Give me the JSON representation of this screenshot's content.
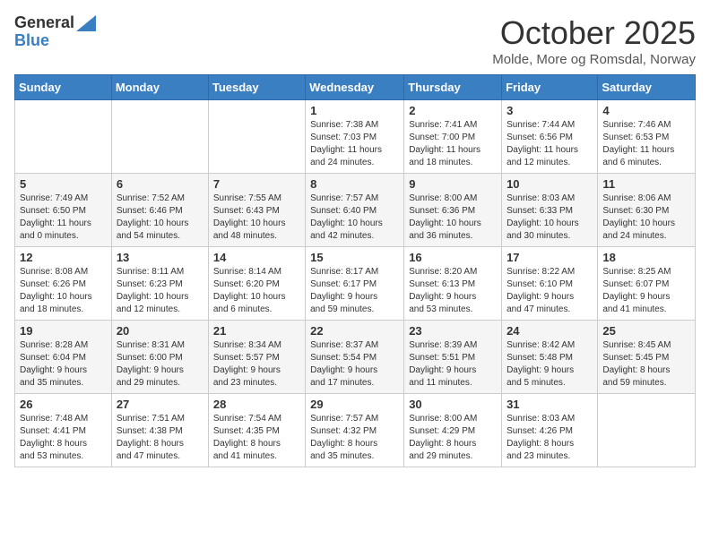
{
  "header": {
    "logo": {
      "line1": "General",
      "line2": "Blue"
    },
    "title": "October 2025",
    "subtitle": "Molde, More og Romsdal, Norway"
  },
  "days_of_week": [
    "Sunday",
    "Monday",
    "Tuesday",
    "Wednesday",
    "Thursday",
    "Friday",
    "Saturday"
  ],
  "weeks": [
    [
      {
        "day": "",
        "info": ""
      },
      {
        "day": "",
        "info": ""
      },
      {
        "day": "",
        "info": ""
      },
      {
        "day": "1",
        "info": "Sunrise: 7:38 AM\nSunset: 7:03 PM\nDaylight: 11 hours\nand 24 minutes."
      },
      {
        "day": "2",
        "info": "Sunrise: 7:41 AM\nSunset: 7:00 PM\nDaylight: 11 hours\nand 18 minutes."
      },
      {
        "day": "3",
        "info": "Sunrise: 7:44 AM\nSunset: 6:56 PM\nDaylight: 11 hours\nand 12 minutes."
      },
      {
        "day": "4",
        "info": "Sunrise: 7:46 AM\nSunset: 6:53 PM\nDaylight: 11 hours\nand 6 minutes."
      }
    ],
    [
      {
        "day": "5",
        "info": "Sunrise: 7:49 AM\nSunset: 6:50 PM\nDaylight: 11 hours\nand 0 minutes."
      },
      {
        "day": "6",
        "info": "Sunrise: 7:52 AM\nSunset: 6:46 PM\nDaylight: 10 hours\nand 54 minutes."
      },
      {
        "day": "7",
        "info": "Sunrise: 7:55 AM\nSunset: 6:43 PM\nDaylight: 10 hours\nand 48 minutes."
      },
      {
        "day": "8",
        "info": "Sunrise: 7:57 AM\nSunset: 6:40 PM\nDaylight: 10 hours\nand 42 minutes."
      },
      {
        "day": "9",
        "info": "Sunrise: 8:00 AM\nSunset: 6:36 PM\nDaylight: 10 hours\nand 36 minutes."
      },
      {
        "day": "10",
        "info": "Sunrise: 8:03 AM\nSunset: 6:33 PM\nDaylight: 10 hours\nand 30 minutes."
      },
      {
        "day": "11",
        "info": "Sunrise: 8:06 AM\nSunset: 6:30 PM\nDaylight: 10 hours\nand 24 minutes."
      }
    ],
    [
      {
        "day": "12",
        "info": "Sunrise: 8:08 AM\nSunset: 6:26 PM\nDaylight: 10 hours\nand 18 minutes."
      },
      {
        "day": "13",
        "info": "Sunrise: 8:11 AM\nSunset: 6:23 PM\nDaylight: 10 hours\nand 12 minutes."
      },
      {
        "day": "14",
        "info": "Sunrise: 8:14 AM\nSunset: 6:20 PM\nDaylight: 10 hours\nand 6 minutes."
      },
      {
        "day": "15",
        "info": "Sunrise: 8:17 AM\nSunset: 6:17 PM\nDaylight: 9 hours\nand 59 minutes."
      },
      {
        "day": "16",
        "info": "Sunrise: 8:20 AM\nSunset: 6:13 PM\nDaylight: 9 hours\nand 53 minutes."
      },
      {
        "day": "17",
        "info": "Sunrise: 8:22 AM\nSunset: 6:10 PM\nDaylight: 9 hours\nand 47 minutes."
      },
      {
        "day": "18",
        "info": "Sunrise: 8:25 AM\nSunset: 6:07 PM\nDaylight: 9 hours\nand 41 minutes."
      }
    ],
    [
      {
        "day": "19",
        "info": "Sunrise: 8:28 AM\nSunset: 6:04 PM\nDaylight: 9 hours\nand 35 minutes."
      },
      {
        "day": "20",
        "info": "Sunrise: 8:31 AM\nSunset: 6:00 PM\nDaylight: 9 hours\nand 29 minutes."
      },
      {
        "day": "21",
        "info": "Sunrise: 8:34 AM\nSunset: 5:57 PM\nDaylight: 9 hours\nand 23 minutes."
      },
      {
        "day": "22",
        "info": "Sunrise: 8:37 AM\nSunset: 5:54 PM\nDaylight: 9 hours\nand 17 minutes."
      },
      {
        "day": "23",
        "info": "Sunrise: 8:39 AM\nSunset: 5:51 PM\nDaylight: 9 hours\nand 11 minutes."
      },
      {
        "day": "24",
        "info": "Sunrise: 8:42 AM\nSunset: 5:48 PM\nDaylight: 9 hours\nand 5 minutes."
      },
      {
        "day": "25",
        "info": "Sunrise: 8:45 AM\nSunset: 5:45 PM\nDaylight: 8 hours\nand 59 minutes."
      }
    ],
    [
      {
        "day": "26",
        "info": "Sunrise: 7:48 AM\nSunset: 4:41 PM\nDaylight: 8 hours\nand 53 minutes."
      },
      {
        "day": "27",
        "info": "Sunrise: 7:51 AM\nSunset: 4:38 PM\nDaylight: 8 hours\nand 47 minutes."
      },
      {
        "day": "28",
        "info": "Sunrise: 7:54 AM\nSunset: 4:35 PM\nDaylight: 8 hours\nand 41 minutes."
      },
      {
        "day": "29",
        "info": "Sunrise: 7:57 AM\nSunset: 4:32 PM\nDaylight: 8 hours\nand 35 minutes."
      },
      {
        "day": "30",
        "info": "Sunrise: 8:00 AM\nSunset: 4:29 PM\nDaylight: 8 hours\nand 29 minutes."
      },
      {
        "day": "31",
        "info": "Sunrise: 8:03 AM\nSunset: 4:26 PM\nDaylight: 8 hours\nand 23 minutes."
      },
      {
        "day": "",
        "info": ""
      }
    ]
  ]
}
